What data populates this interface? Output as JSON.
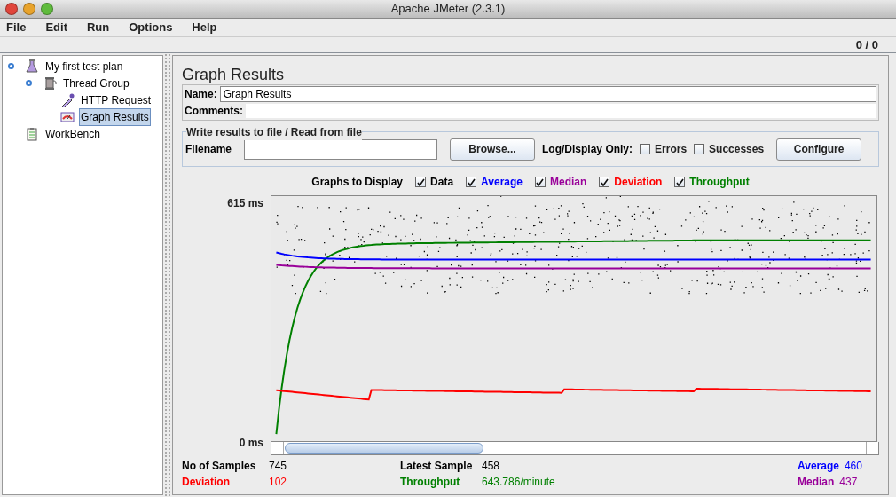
{
  "window": {
    "title": "Apache JMeter (2.3.1)"
  },
  "menu": [
    "File",
    "Edit",
    "Run",
    "Options",
    "Help"
  ],
  "toolbar": {
    "counter": "0 / 0"
  },
  "tree": [
    {
      "label": "My first test plan",
      "kind": "plan",
      "selected": false,
      "children": [
        {
          "label": "Thread Group",
          "kind": "threads",
          "selected": false,
          "children": [
            {
              "label": "HTTP Request",
              "kind": "sampler",
              "selected": false
            },
            {
              "label": "Graph Results",
              "kind": "listener",
              "selected": true
            }
          ]
        }
      ]
    },
    {
      "label": "WorkBench",
      "kind": "workbench",
      "selected": false
    }
  ],
  "panel": {
    "title": "Graph Results",
    "name_label": "Name:",
    "name_value": "Graph Results",
    "comments_label": "Comments:",
    "file_group": {
      "title": "Write results to file / Read from file",
      "filename_label": "Filename",
      "browse": "Browse...",
      "log_label": "Log/Display Only:",
      "options": [
        {
          "label": "Errors",
          "checked": false
        },
        {
          "label": "Successes",
          "checked": false
        }
      ],
      "configure": "Configure"
    },
    "graphs_label": "Graphs to Display",
    "graphs": [
      {
        "label": "Data",
        "checked": true,
        "color": "#000000"
      },
      {
        "label": "Average",
        "checked": true,
        "color": "#0000ff"
      },
      {
        "label": "Median",
        "checked": true,
        "color": "#990099"
      },
      {
        "label": "Deviation",
        "checked": true,
        "color": "#ff0000"
      },
      {
        "label": "Throughput",
        "checked": true,
        "color": "#008000"
      }
    ],
    "y_max": "615 ms",
    "y_min": "0 ms",
    "stats": [
      {
        "label": "No of Samples",
        "value": "745",
        "color": "#000000"
      },
      {
        "label": "Latest Sample",
        "value": "458",
        "color": "#000000"
      },
      {
        "label": "Average",
        "value": "460",
        "color": "#0000ff"
      },
      {
        "label": "Deviation",
        "value": "102",
        "color": "#ff0000"
      },
      {
        "label": "Throughput",
        "value": "643.786/minute",
        "color": "#008000"
      },
      {
        "label": "Median",
        "value": "437",
        "color": "#990099"
      }
    ]
  }
}
